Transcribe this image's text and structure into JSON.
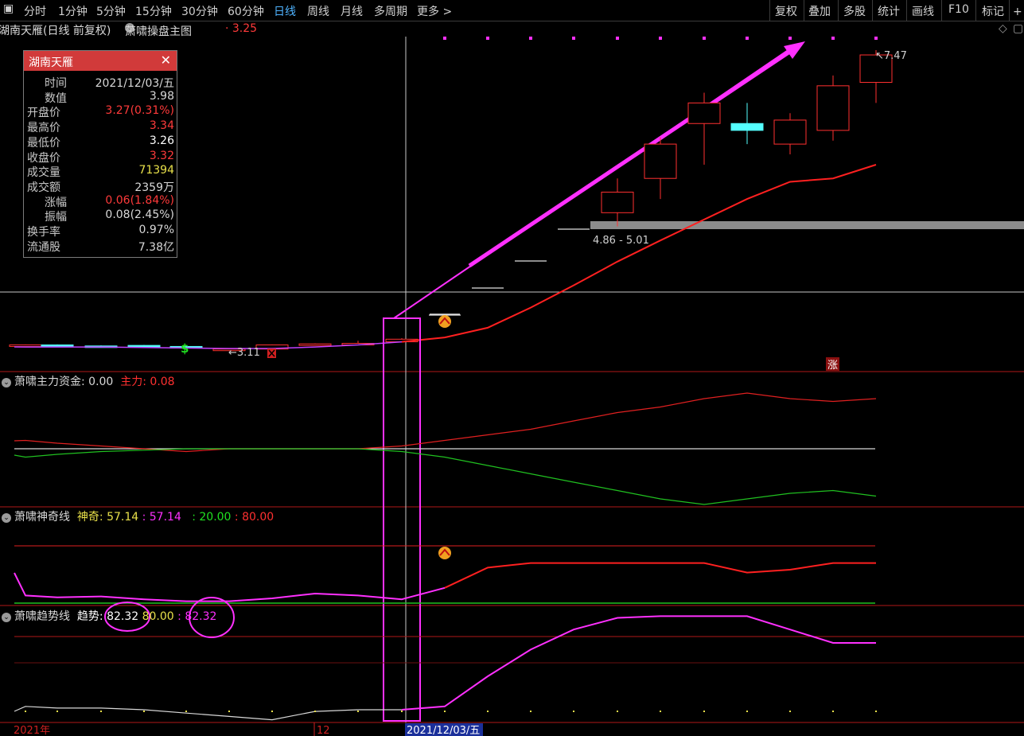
{
  "toolbar": {
    "periods": [
      "分时",
      "1分钟",
      "5分钟",
      "15分钟",
      "30分钟",
      "60分钟",
      "日线",
      "周线",
      "月线",
      "多周期",
      "更多 >"
    ],
    "active_period": "日线",
    "right_buttons": [
      "复权",
      "叠加",
      "多股",
      "统计",
      "画线",
      "F10",
      "标记",
      "+自"
    ]
  },
  "titlebar": {
    "stock_title": "湖南天雁(日线 前复权)",
    "indicator_name": "萧啸操盘主图",
    "indicator_value": "· 3.25"
  },
  "info_panel": {
    "title": "湖南天雁",
    "close_glyph": "✕",
    "rows": [
      {
        "label": "时间",
        "value": "2021/12/03/五",
        "color": "#d8d8d8"
      },
      {
        "label": "数值",
        "value": "3.98",
        "color": "#d8d8d8"
      },
      {
        "label": "开盘价",
        "value": "3.27(0.31%)",
        "color": "#ff3a3a"
      },
      {
        "label": "最高价",
        "value": "3.34",
        "color": "#ff3a3a"
      },
      {
        "label": "最低价",
        "value": "3.26",
        "color": "#ffffff"
      },
      {
        "label": "收盘价",
        "value": "3.32",
        "color": "#ff3a3a"
      },
      {
        "label": "成交量",
        "value": "71394",
        "color": "#e8e04a"
      },
      {
        "label": "成交额",
        "value": "2359万",
        "color": "#d8d8d8"
      },
      {
        "label": "涨幅",
        "value": "0.06(1.84%)",
        "color": "#ff3a3a"
      },
      {
        "label": "振幅",
        "value": "0.08(2.45%)",
        "color": "#d8d8d8"
      },
      {
        "label": "换手率",
        "value": "0.97%",
        "color": "#d8d8d8"
      },
      {
        "label": "流通股",
        "value": "7.38亿",
        "color": "#d8d8d8"
      }
    ]
  },
  "colors": {
    "up": "#ff3030",
    "down": "#54ffff",
    "ma": "#ff2020",
    "trend": "#ff30ff",
    "green": "#20c020",
    "grid": "#b01818",
    "white": "#e0e0e0"
  },
  "chart_data": [
    {
      "type": "candlestick",
      "title": "萧啸操盘主图",
      "x": [
        1,
        2,
        3,
        4,
        5,
        6,
        7,
        8,
        9,
        10,
        11,
        12,
        13,
        14,
        15,
        16,
        17,
        18,
        19,
        20
      ],
      "ohlc": [
        [
          3.2,
          3.22,
          3.19,
          3.21
        ],
        [
          3.21,
          3.22,
          3.19,
          3.2
        ],
        [
          3.19,
          3.2,
          3.17,
          3.18
        ],
        [
          3.2,
          3.21,
          3.18,
          3.19
        ],
        [
          3.18,
          3.19,
          3.14,
          3.15
        ],
        [
          3.12,
          3.14,
          3.11,
          3.13
        ],
        [
          3.13,
          3.22,
          3.12,
          3.21
        ],
        [
          3.22,
          3.24,
          3.21,
          3.23
        ],
        [
          3.23,
          3.29,
          3.22,
          3.24
        ],
        [
          3.27,
          3.34,
          3.26,
          3.32
        ],
        [
          3.65,
          3.65,
          3.65,
          3.65
        ],
        [
          4.01,
          4.01,
          4.01,
          4.01
        ],
        [
          4.41,
          4.41,
          4.41,
          4.41
        ],
        [
          4.86,
          4.86,
          4.86,
          4.86
        ],
        [
          5.1,
          5.6,
          4.9,
          5.4
        ],
        [
          5.6,
          6.2,
          5.3,
          6.1
        ],
        [
          6.4,
          6.85,
          5.8,
          6.7
        ],
        [
          6.4,
          6.7,
          6.1,
          6.3
        ],
        [
          6.1,
          6.55,
          5.95,
          6.45
        ],
        [
          6.3,
          7.1,
          6.15,
          6.95
        ],
        [
          7.0,
          7.47,
          6.7,
          7.4
        ]
      ],
      "annotations": [
        "3.11",
        "4.86 - 5.01",
        "7.47"
      ],
      "signal_labels": [
        "$",
        "涨"
      ],
      "price_band": [
        4.86,
        5.01
      ]
    },
    {
      "type": "line",
      "title": "萧啸主力资金",
      "readout": [
        ": 0.00",
        "主力: 0.08"
      ],
      "x": [
        1,
        2,
        3,
        4,
        5,
        6,
        7,
        8,
        9,
        10,
        11,
        12,
        13,
        14,
        15,
        16,
        17,
        18,
        19,
        20,
        21
      ],
      "series": [
        {
          "name": "主力",
          "values": [
            0.03,
            0.02,
            0.01,
            0.0,
            -0.01,
            0.0,
            0.0,
            0.0,
            0.0,
            0.01,
            0.03,
            0.05,
            0.07,
            0.1,
            0.13,
            0.15,
            0.18,
            0.2,
            0.18,
            0.17,
            0.18
          ]
        },
        {
          "values": [
            -0.03,
            -0.02,
            -0.01,
            -0.005,
            0.0,
            0.0,
            0.0,
            0.0,
            0.0,
            -0.01,
            -0.03,
            -0.06,
            -0.09,
            -0.12,
            -0.15,
            -0.18,
            -0.2,
            -0.18,
            -0.16,
            -0.15,
            -0.17
          ]
        }
      ]
    },
    {
      "type": "line",
      "title": "萧啸神奇线",
      "readout": [
        "神奇: 57.14",
        ": 57.14",
        ": 20.00",
        ": 80.00"
      ],
      "x": [
        1,
        2,
        3,
        4,
        5,
        6,
        7,
        8,
        9,
        10,
        11,
        12,
        13,
        14,
        15,
        16,
        17,
        18,
        19,
        20,
        21
      ],
      "series": [
        {
          "name": "神奇",
          "values": [
            28,
            26,
            27,
            24,
            22,
            22,
            25,
            30,
            28,
            24,
            36,
            57.14,
            62,
            62,
            62,
            62,
            62,
            52,
            55,
            62,
            62
          ]
        }
      ],
      "reference_lines": [
        20,
        80
      ]
    },
    {
      "type": "line",
      "title": "萧啸趋势线",
      "readout": [
        "趋势: 82.32",
        "80.00",
        ": 82.32"
      ],
      "x": [
        1,
        2,
        3,
        4,
        5,
        6,
        7,
        8,
        9,
        10,
        11,
        12,
        13,
        14,
        15,
        16,
        17,
        18,
        19,
        20,
        21
      ],
      "series": [
        {
          "name": "趋势",
          "values": [
            2,
            1,
            1,
            0,
            -2,
            -4,
            -6,
            -1,
            0,
            0,
            2,
            20,
            36,
            48,
            55,
            56,
            56,
            56,
            48,
            40,
            40,
            42
          ]
        }
      ]
    }
  ],
  "axis": {
    "labels": [
      "2021年",
      "12",
      "2021/12/03/五"
    ]
  }
}
